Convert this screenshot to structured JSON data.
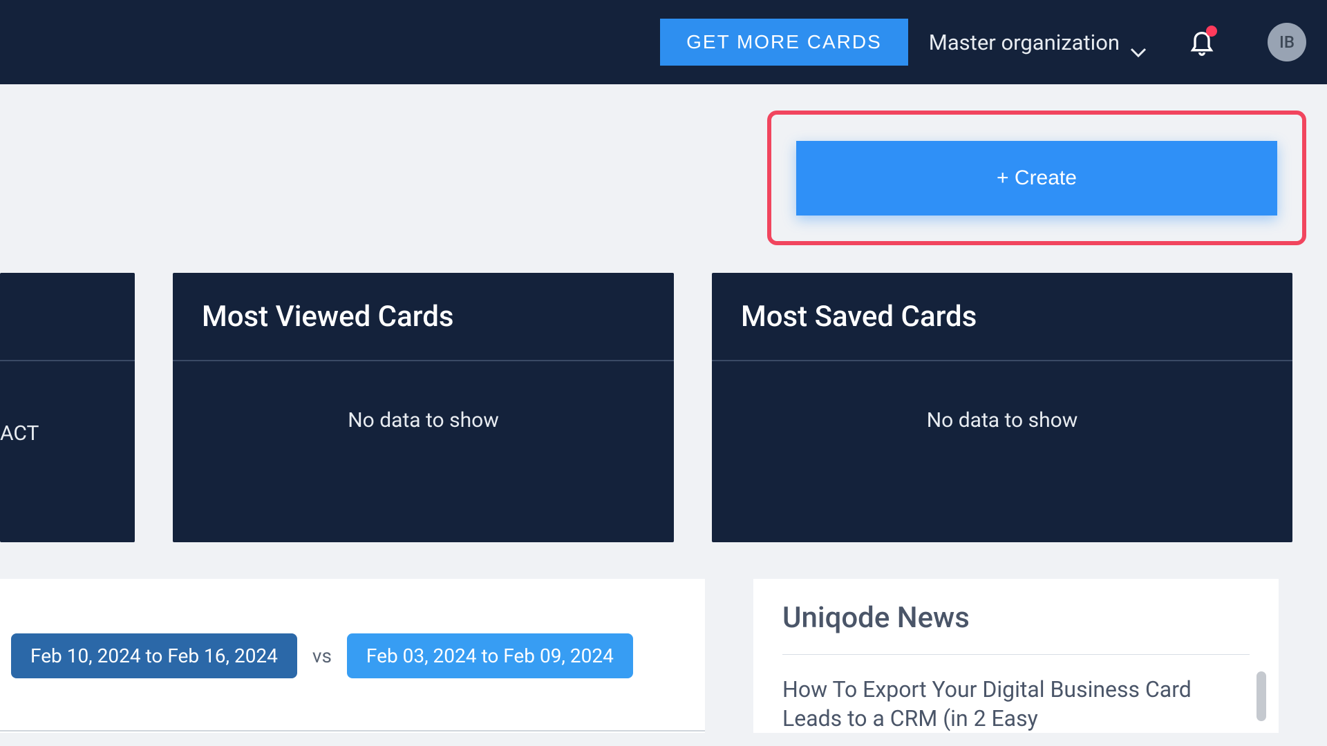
{
  "header": {
    "get_more_label": "GET MORE CARDS",
    "org_label": "Master organization",
    "avatar_initials": "IB"
  },
  "create": {
    "label": "+ Create"
  },
  "cards": {
    "partial_label": "ACT",
    "most_viewed": {
      "title": "Most Viewed Cards",
      "empty": "No data to show"
    },
    "most_saved": {
      "title": "Most Saved Cards",
      "empty": "No data to show"
    }
  },
  "dates": {
    "primary": "Feb 10, 2024 to Feb 16, 2024",
    "vs": "vs",
    "secondary": "Feb 03, 2024 to Feb 09, 2024"
  },
  "news": {
    "title": "Uniqode News",
    "item1": "How To Export Your Digital Business Card Leads to a CRM (in 2 Easy"
  }
}
